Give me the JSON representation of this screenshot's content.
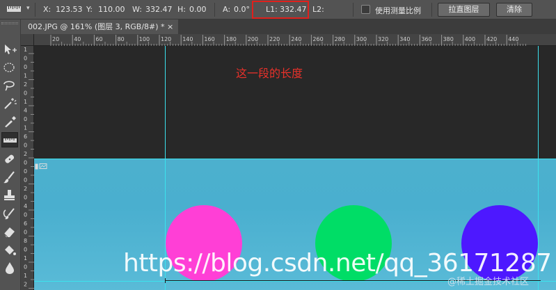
{
  "options_bar": {
    "tool_icon": "ruler-icon",
    "x_label": "X:",
    "x_value": "123.53",
    "y_label": "Y:",
    "y_value": "110.00",
    "w_label": "W:",
    "w_value": "332.47",
    "h_label": "H:",
    "h_value": "0.00",
    "a_label": "A:",
    "a_value": "0.0°",
    "l1_label": "L1:",
    "l1_value": "332.47",
    "l2_label": "L2:",
    "use_scale_label": "使用测量比例",
    "straighten_button": "拉直图层",
    "clear_button": "清除",
    "highlight_color": "#e0201c"
  },
  "document_tab": {
    "title": "002.JPG @ 161% (图层 3, RGB/8#) *",
    "close": "×"
  },
  "ruler": {
    "h_labels": [
      "20",
      "40",
      "60",
      "80",
      "100",
      "120",
      "140",
      "160",
      "180",
      "200",
      "220",
      "240",
      "260",
      "280",
      "300",
      "320",
      "340",
      "360",
      "380",
      "400",
      "420",
      "440"
    ],
    "v_labels": [
      "1",
      "0",
      "0",
      "1",
      "2",
      "0",
      "1",
      "4",
      "0",
      "1",
      "6",
      "0",
      "2",
      "0",
      "0",
      "0",
      "2",
      "0",
      "4",
      "0",
      "6",
      "0",
      "8",
      "0",
      "1",
      "0",
      "1",
      "2"
    ]
  },
  "canvas": {
    "annotation": "这一段的长度",
    "annotation_color": "#e8312a",
    "circle_colors": [
      "#ff3fd6",
      "#00dd66",
      "#4d18ff"
    ],
    "guide_color": "#3ce2ee",
    "watermark": "https://blog.csdn.net/qq_36171287",
    "watermark_sub": "@稀土掘金技术社区"
  },
  "tools": [
    "move-icon",
    "marquee-icon",
    "lasso-icon",
    "magic-wand-icon",
    "eyedropper-icon",
    "ruler-icon",
    "healing-brush-icon",
    "brush-icon",
    "stamp-icon",
    "history-brush-icon",
    "eraser-icon",
    "paint-bucket-icon",
    "blur-icon"
  ]
}
